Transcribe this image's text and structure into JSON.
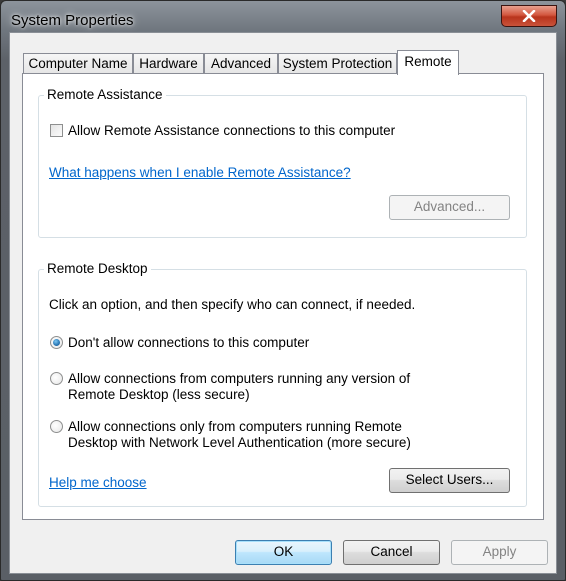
{
  "window": {
    "title": "System Properties"
  },
  "tabs": [
    {
      "label": "Computer Name",
      "active": false
    },
    {
      "label": "Hardware",
      "active": false
    },
    {
      "label": "Advanced",
      "active": false
    },
    {
      "label": "System Protection",
      "active": false
    },
    {
      "label": "Remote",
      "active": true
    }
  ],
  "remote_assistance": {
    "group_label": "Remote Assistance",
    "allow_checkbox_label": "Allow Remote Assistance connections to this computer",
    "allow_checked": false,
    "help_link": "What happens when I enable Remote Assistance?",
    "advanced_button": "Advanced..."
  },
  "remote_desktop": {
    "group_label": "Remote Desktop",
    "instruction": "Click an option, and then specify who can connect, if needed.",
    "options": [
      {
        "line1": "Don't allow connections to this computer",
        "line2": "",
        "selected": true
      },
      {
        "line1": "Allow connections from computers running any version of",
        "line2": "Remote Desktop (less secure)",
        "selected": false
      },
      {
        "line1": "Allow connections only from computers running Remote",
        "line2": "Desktop with Network Level Authentication (more secure)",
        "selected": false
      }
    ],
    "help_link": "Help me choose",
    "select_users_button": "Select Users..."
  },
  "footer": {
    "ok": "OK",
    "cancel": "Cancel",
    "apply": "Apply"
  },
  "icons": {
    "close": "close-icon"
  }
}
